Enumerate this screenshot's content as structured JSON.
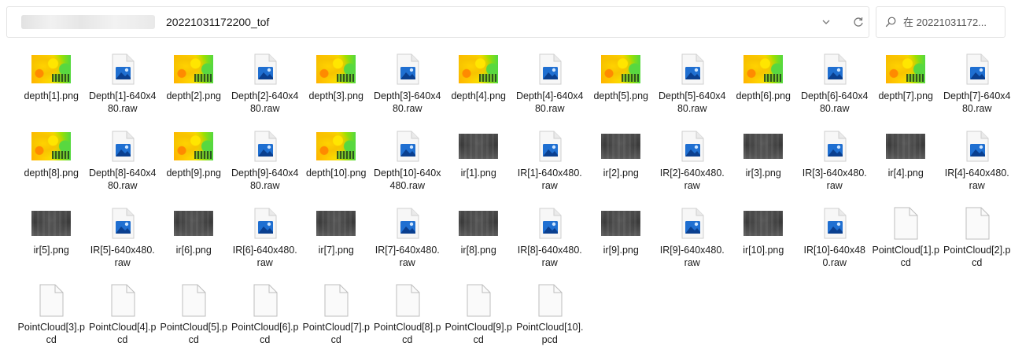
{
  "address_bar": {
    "path": "20221031172200_tof",
    "dropdown_icon": "chevron-down-icon",
    "refresh_icon": "refresh-icon"
  },
  "search": {
    "icon": "search-icon",
    "placeholder": "在 20221031172..."
  },
  "files": [
    {
      "name": "depth[1].png",
      "type": "depth"
    },
    {
      "name": "Depth[1]-640x480.raw",
      "type": "raw"
    },
    {
      "name": "depth[2].png",
      "type": "depth"
    },
    {
      "name": "Depth[2]-640x480.raw",
      "type": "raw"
    },
    {
      "name": "depth[3].png",
      "type": "depth"
    },
    {
      "name": "Depth[3]-640x480.raw",
      "type": "raw"
    },
    {
      "name": "depth[4].png",
      "type": "depth"
    },
    {
      "name": "Depth[4]-640x480.raw",
      "type": "raw"
    },
    {
      "name": "depth[5].png",
      "type": "depth"
    },
    {
      "name": "Depth[5]-640x480.raw",
      "type": "raw"
    },
    {
      "name": "depth[6].png",
      "type": "depth"
    },
    {
      "name": "Depth[6]-640x480.raw",
      "type": "raw"
    },
    {
      "name": "depth[7].png",
      "type": "depth"
    },
    {
      "name": "Depth[7]-640x480.raw",
      "type": "raw"
    },
    {
      "name": "depth[8].png",
      "type": "depth"
    },
    {
      "name": "Depth[8]-640x480.raw",
      "type": "raw"
    },
    {
      "name": "depth[9].png",
      "type": "depth"
    },
    {
      "name": "Depth[9]-640x480.raw",
      "type": "raw"
    },
    {
      "name": "depth[10].png",
      "type": "depth"
    },
    {
      "name": "Depth[10]-640x480.raw",
      "type": "raw"
    },
    {
      "name": "ir[1].png",
      "type": "ir"
    },
    {
      "name": "IR[1]-640x480.raw",
      "type": "raw"
    },
    {
      "name": "ir[2].png",
      "type": "ir"
    },
    {
      "name": "IR[2]-640x480.raw",
      "type": "raw"
    },
    {
      "name": "ir[3].png",
      "type": "ir"
    },
    {
      "name": "IR[3]-640x480.raw",
      "type": "raw"
    },
    {
      "name": "ir[4].png",
      "type": "ir"
    },
    {
      "name": "IR[4]-640x480.raw",
      "type": "raw"
    },
    {
      "name": "ir[5].png",
      "type": "ir"
    },
    {
      "name": "IR[5]-640x480.raw",
      "type": "raw"
    },
    {
      "name": "ir[6].png",
      "type": "ir"
    },
    {
      "name": "IR[6]-640x480.raw",
      "type": "raw"
    },
    {
      "name": "ir[7].png",
      "type": "ir"
    },
    {
      "name": "IR[7]-640x480.raw",
      "type": "raw"
    },
    {
      "name": "ir[8].png",
      "type": "ir"
    },
    {
      "name": "IR[8]-640x480.raw",
      "type": "raw"
    },
    {
      "name": "ir[9].png",
      "type": "ir"
    },
    {
      "name": "IR[9]-640x480.raw",
      "type": "raw"
    },
    {
      "name": "ir[10].png",
      "type": "ir"
    },
    {
      "name": "IR[10]-640x480.raw",
      "type": "raw"
    },
    {
      "name": "PointCloud[1].pcd",
      "type": "pcd"
    },
    {
      "name": "PointCloud[2].pcd",
      "type": "pcd"
    },
    {
      "name": "PointCloud[3].pcd",
      "type": "pcd"
    },
    {
      "name": "PointCloud[4].pcd",
      "type": "pcd"
    },
    {
      "name": "PointCloud[5].pcd",
      "type": "pcd"
    },
    {
      "name": "PointCloud[6].pcd",
      "type": "pcd"
    },
    {
      "name": "PointCloud[7].pcd",
      "type": "pcd"
    },
    {
      "name": "PointCloud[8].pcd",
      "type": "pcd"
    },
    {
      "name": "PointCloud[9].pcd",
      "type": "pcd"
    },
    {
      "name": "PointCloud[10].pcd",
      "type": "pcd"
    }
  ],
  "icons": {
    "depth": "depth-image-thumbnail",
    "ir": "ir-image-thumbnail",
    "raw": "image-file-icon",
    "pcd": "blank-file-icon"
  }
}
